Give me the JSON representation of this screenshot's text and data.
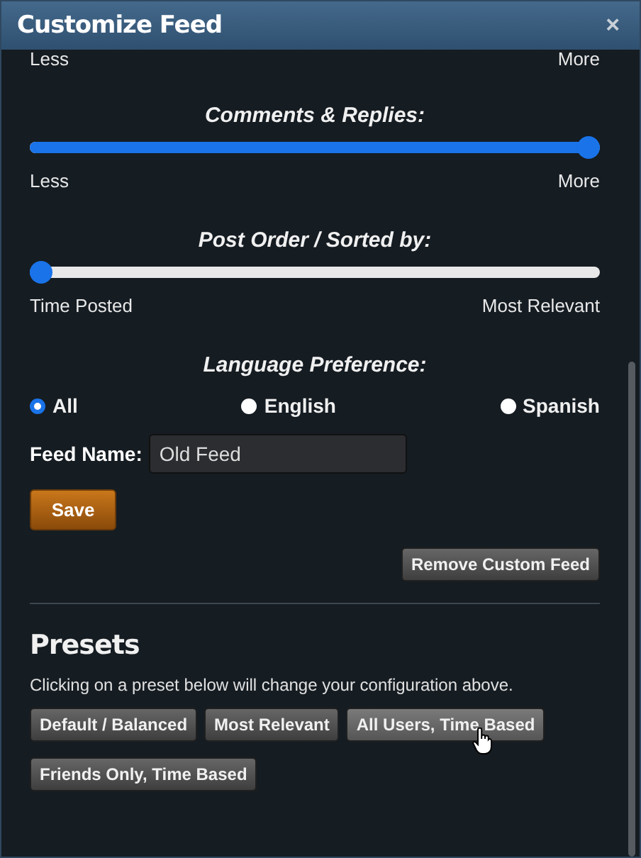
{
  "window": {
    "title": "Customize Feed",
    "close": "×"
  },
  "top_labels": {
    "min": "Less",
    "max": "More"
  },
  "sliders": [
    {
      "heading": "Comments & Replies:",
      "level": 1,
      "min": "Less",
      "max": "More"
    },
    {
      "heading": "Post Order / Sorted by:",
      "level": 0,
      "min": "Time Posted",
      "max": "Most Relevant"
    }
  ],
  "language": {
    "heading": "Language Preference:",
    "options": [
      {
        "label": "All",
        "selected": true
      },
      {
        "label": "English",
        "selected": false
      },
      {
        "label": "Spanish",
        "selected": false
      }
    ]
  },
  "feed_name": {
    "label": "Feed Name:",
    "value": "Old Feed"
  },
  "save_button": "Save",
  "remove_button": "Remove Custom Feed",
  "presets": {
    "title": "Presets",
    "description": "Clicking on a preset below will change your configuration above.",
    "buttons": [
      {
        "label": "Default / Balanced",
        "hovered": false
      },
      {
        "label": "Most Relevant",
        "hovered": false
      },
      {
        "label": "All Users, Time Based",
        "hovered": true
      },
      {
        "label": "Friends Only, Time Based",
        "hovered": false
      }
    ]
  }
}
